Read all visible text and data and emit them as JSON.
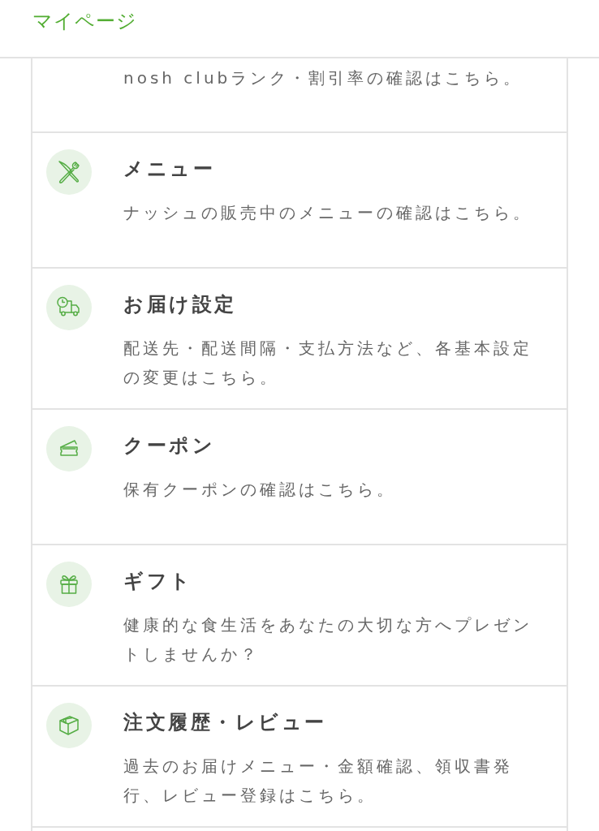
{
  "header": {
    "title": "マイページ"
  },
  "items": [
    {
      "kind": "cut",
      "description": "nosh clubランク・割引率の確認はこちら。"
    },
    {
      "kind": "menu",
      "title": "メニュー",
      "description": "ナッシュの販売中のメニューの確認はこちら。"
    },
    {
      "kind": "delivery",
      "title": "お届け設定",
      "description": "配送先・配送間隔・支払方法など、各基本設定の変更はこちら。"
    },
    {
      "kind": "coupon",
      "title": "クーポン",
      "description": "保有クーポンの確認はこちら。"
    },
    {
      "kind": "gift",
      "title": "ギフト",
      "description": "健康的な食生活をあなたの大切な方へプレゼントしませんか？"
    },
    {
      "kind": "orders",
      "title": "注文履歴・レビュー",
      "description": "過去のお届けメニュー・金額確認、領収書発行、レビュー登録はこちら。"
    }
  ]
}
